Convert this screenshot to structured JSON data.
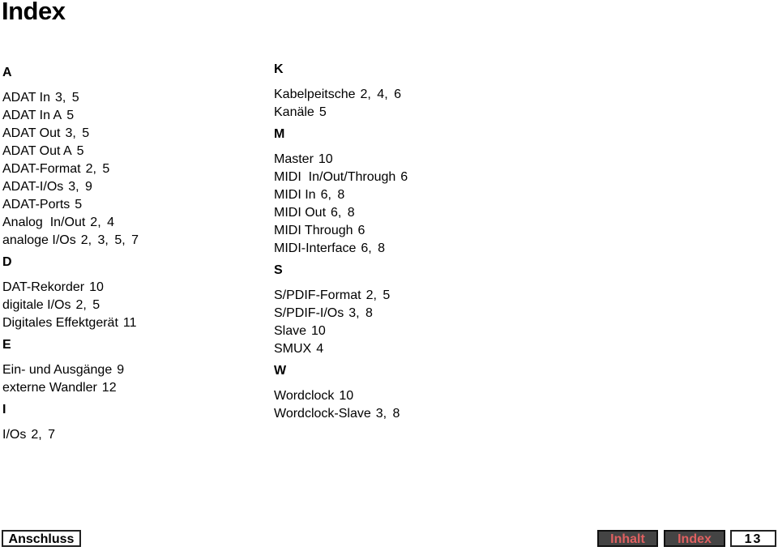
{
  "page_title": "Index",
  "left_column": [
    {
      "letter": "A",
      "entries": [
        {
          "term": "ADAT In",
          "pages": "3, 5"
        },
        {
          "term": "ADAT In A",
          "pages": "5"
        },
        {
          "term": "ADAT Out",
          "pages": "3, 5"
        },
        {
          "term": "ADAT Out A",
          "pages": "5"
        },
        {
          "term": "ADAT-Format",
          "pages": "2, 5"
        },
        {
          "term": "ADAT-I/Os",
          "pages": "3, 9"
        },
        {
          "term": "ADAT-Ports",
          "pages": "5"
        },
        {
          "term": "Analog  In/Out",
          "pages": "2, 4"
        },
        {
          "term": "analoge I/Os",
          "pages": "2, 3, 5, 7"
        }
      ]
    },
    {
      "letter": "D",
      "entries": [
        {
          "term": "DAT-Rekorder",
          "pages": "10"
        },
        {
          "term": "digitale I/Os",
          "pages": "2, 5"
        },
        {
          "term": "Digitales Effektgerät",
          "pages": "11"
        }
      ]
    },
    {
      "letter": "E",
      "entries": [
        {
          "term": "Ein- und Ausgänge",
          "pages": "9"
        },
        {
          "term": "externe Wandler",
          "pages": "12"
        }
      ]
    },
    {
      "letter": "I",
      "entries": [
        {
          "term": "I/Os",
          "pages": "2, 7"
        }
      ]
    }
  ],
  "right_column": [
    {
      "letter": "K",
      "entries": [
        {
          "term": "Kabelpeitsche",
          "pages": "2, 4, 6"
        },
        {
          "term": "Kanäle",
          "pages": "5"
        }
      ]
    },
    {
      "letter": "M",
      "entries": [
        {
          "term": "Master",
          "pages": "10"
        },
        {
          "term": "MIDI  In/Out/Through",
          "pages": "6"
        },
        {
          "term": "MIDI In",
          "pages": "6, 8"
        },
        {
          "term": "MIDI Out",
          "pages": "6, 8"
        },
        {
          "term": "MIDI Through",
          "pages": "6"
        },
        {
          "term": "MIDI-Interface",
          "pages": "6, 8"
        }
      ]
    },
    {
      "letter": "S",
      "entries": [
        {
          "term": "S/PDIF-Format",
          "pages": "2, 5"
        },
        {
          "term": "S/PDIF-I/Os",
          "pages": "3, 8"
        },
        {
          "term": "Slave",
          "pages": "10"
        },
        {
          "term": "SMUX",
          "pages": "4"
        }
      ]
    },
    {
      "letter": "W",
      "entries": [
        {
          "term": "Wordclock",
          "pages": "10"
        },
        {
          "term": "Wordclock-Slave",
          "pages": "3, 8"
        }
      ]
    }
  ],
  "footer": {
    "anschluss_label": "Anschluss",
    "inhalt_label": "Inhalt",
    "index_label": "Index",
    "page_number": "13"
  },
  "colors": {
    "nav_button_bg": "#444444",
    "nav_button_text": "#e06060"
  }
}
